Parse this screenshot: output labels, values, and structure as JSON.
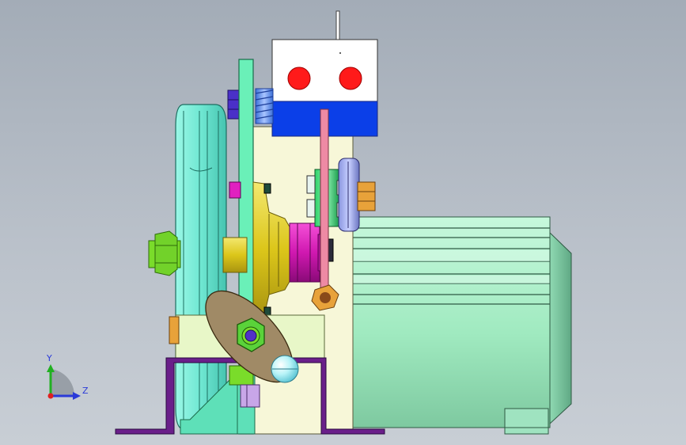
{
  "triad": {
    "y_label": "Y",
    "z_label": "Z"
  },
  "colors": {
    "background_top": "#a3acb7",
    "background_bottom": "#c8ced5",
    "motor_body": "#a8f0c8",
    "pulley": "#7cf2dc",
    "frame_plate": "#f7f7d8",
    "bracket": "#6a1f8a",
    "switch_top": "#ffffff",
    "switch_bottom": "#0b3fe8",
    "indicator_red": "#ff1a1a",
    "cam_plate": "#a08a66",
    "gear_magenta": "#e020c0",
    "hub_yellow": "#e6d21e",
    "nut_green": "#7adc2a",
    "nut_orange": "#e8a23a",
    "spring_blue": "#5a8ae0",
    "axis_y": "#21b021",
    "axis_z": "#2a3ad8"
  }
}
